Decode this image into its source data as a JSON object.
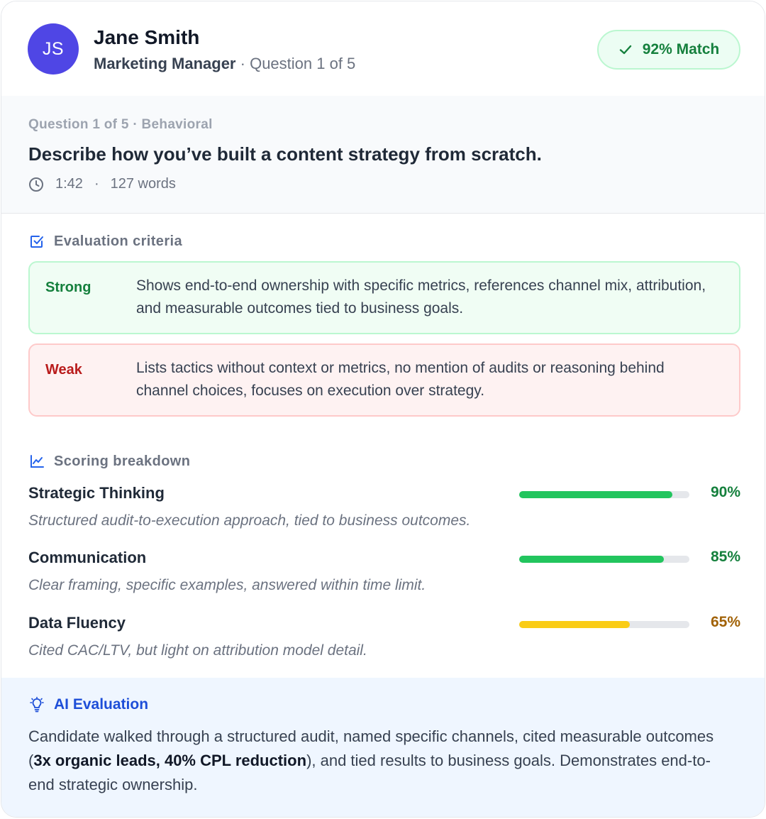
{
  "candidate": {
    "initials": "JS",
    "name": "Jane Smith",
    "role": "Marketing Manager",
    "separator": "·",
    "progress": "Question 1 of 5"
  },
  "match": {
    "label": "92% Match",
    "percent": 92,
    "icon": "check-icon"
  },
  "question": {
    "meta": "Question 1 of 5 · Behavioral",
    "text": "Describe how you’ve built a content strategy from scratch.",
    "duration": "1:42",
    "dot": "·",
    "words": "127 words"
  },
  "criteria": {
    "title": "Evaluation criteria",
    "icon": "checkbox-icon",
    "strong": {
      "label": "Strong",
      "text": "Shows end-to-end ownership with specific metrics, references channel mix, attribution, and measurable outcomes tied to business goals."
    },
    "weak": {
      "label": "Weak",
      "text": "Lists tactics without context or metrics, no mention of audits or reasoning behind channel choices, focuses on execution over strategy."
    }
  },
  "scoring": {
    "title": "Scoring breakdown",
    "icon": "line-chart-icon",
    "items": [
      {
        "name": "Strategic Thinking",
        "desc": "Structured audit-to-execution approach, tied to business outcomes.",
        "pct_label": "90%",
        "value": 0.9,
        "color": "#22c55e",
        "text_color": "#15803d"
      },
      {
        "name": "Communication",
        "desc": "Clear framing, specific examples, answered within time limit.",
        "pct_label": "85%",
        "value": 0.85,
        "color": "#22c55e",
        "text_color": "#15803d"
      },
      {
        "name": "Data Fluency",
        "desc": "Cited CAC/LTV, but light on attribution model detail.",
        "pct_label": "65%",
        "value": 0.65,
        "color": "#facc15",
        "text_color": "#a16207"
      }
    ]
  },
  "ai": {
    "title": "AI Evaluation",
    "icon": "lightbulb-icon",
    "text_before": "Candidate walked through a structured audit, named specific channels, cited measurable outcomes (",
    "highlight": "3x organic leads, 40% CPL reduction",
    "text_after": "), and tied results to business goals. Demonstrates end-to-end strategic ownership."
  }
}
